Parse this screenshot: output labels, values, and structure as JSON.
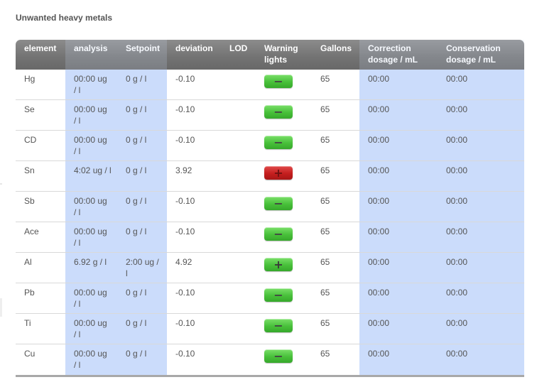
{
  "title": "Unwanted heavy metals",
  "columns": [
    {
      "key": "element",
      "label": "element"
    },
    {
      "key": "analysis",
      "label": "analysis"
    },
    {
      "key": "setpoint",
      "label": "Setpoint"
    },
    {
      "key": "deviation",
      "label": "deviation"
    },
    {
      "key": "lod",
      "label": "LOD"
    },
    {
      "key": "warning",
      "label": "Warning lights"
    },
    {
      "key": "gallons",
      "label": "Gallons"
    },
    {
      "key": "correction",
      "label": "Correction dosage / mL"
    },
    {
      "key": "conservation",
      "label": "Conservation dosage / mL"
    }
  ],
  "rows": [
    {
      "element": "Hg",
      "analysis": "00:00 ug / l",
      "setpoint": "0 g / l",
      "deviation": "-0.10",
      "lod": "",
      "warning": "−",
      "warning_state": "ok",
      "gallons": "65",
      "correction": "00:00",
      "conservation": "00:00"
    },
    {
      "element": "Se",
      "analysis": "00:00 ug / l",
      "setpoint": "0 g / l",
      "deviation": "-0.10",
      "lod": "",
      "warning": "−",
      "warning_state": "ok",
      "gallons": "65",
      "correction": "00:00",
      "conservation": "00:00"
    },
    {
      "element": "CD",
      "analysis": "00:00 ug / l",
      "setpoint": "0 g / l",
      "deviation": "-0.10",
      "lod": "",
      "warning": "−",
      "warning_state": "ok",
      "gallons": "65",
      "correction": "00:00",
      "conservation": "00:00"
    },
    {
      "element": "Sn",
      "analysis": "4:02 ug / l",
      "setpoint": "0 g / l",
      "deviation": "3.92",
      "lod": "",
      "warning": "+",
      "warning_state": "alert",
      "gallons": "65",
      "correction": "00:00",
      "conservation": "00:00"
    },
    {
      "element": "Sb",
      "analysis": "00:00 ug / l",
      "setpoint": "0 g / l",
      "deviation": "-0.10",
      "lod": "",
      "warning": "−",
      "warning_state": "ok",
      "gallons": "65",
      "correction": "00:00",
      "conservation": "00:00"
    },
    {
      "element": "Ace",
      "analysis": "00:00 ug / l",
      "setpoint": "0 g / l",
      "deviation": "-0.10",
      "lod": "",
      "warning": "−",
      "warning_state": "ok",
      "gallons": "65",
      "correction": "00:00",
      "conservation": "00:00"
    },
    {
      "element": "Al",
      "analysis": "6.92 g / l",
      "setpoint": "2:00 ug / l",
      "deviation": "4.92",
      "lod": "",
      "warning": "+",
      "warning_state": "ok-plus",
      "gallons": "65",
      "correction": "00:00",
      "conservation": "00:00"
    },
    {
      "element": "Pb",
      "analysis": "00:00 ug / l",
      "setpoint": "0 g / l",
      "deviation": "-0.10",
      "lod": "",
      "warning": "−",
      "warning_state": "ok",
      "gallons": "65",
      "correction": "00:00",
      "conservation": "00:00"
    },
    {
      "element": "Ti",
      "analysis": "00:00 ug / l",
      "setpoint": "0 g / l",
      "deviation": "-0.10",
      "lod": "",
      "warning": "−",
      "warning_state": "ok",
      "gallons": "65",
      "correction": "00:00",
      "conservation": "00:00"
    },
    {
      "element": "Cu",
      "analysis": "00:00 ug / l",
      "setpoint": "0 g / l",
      "deviation": "-0.10",
      "lod": "",
      "warning": "−",
      "warning_state": "ok",
      "gallons": "65",
      "correction": "00:00",
      "conservation": "00:00"
    }
  ],
  "colors": {
    "header_bg": "#747474",
    "highlight_col": "#cbdcfb",
    "ok_light": "#48c03a",
    "alert_light": "#c41e1e",
    "text": "#555555"
  }
}
